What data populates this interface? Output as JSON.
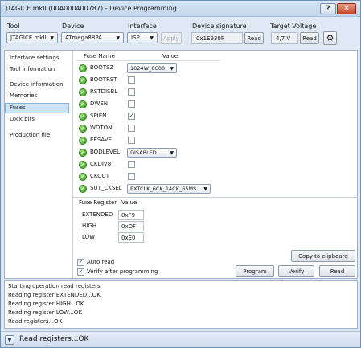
{
  "window": {
    "title": "JTAGICE mkII (00A000400787) - Device Programming"
  },
  "toolbar": {
    "tool_label": "Tool",
    "tool_value": "JTAGICE mkII",
    "device_label": "Device",
    "device_value": "ATmega88PA",
    "interface_label": "Interface",
    "interface_value": "ISP",
    "apply_label": "Apply",
    "signature_label": "Device signature",
    "signature_value": "0x1E930F",
    "read_label": "Read",
    "voltage_label": "Target Voltage",
    "voltage_value": "4,7 V"
  },
  "sidebar": {
    "items": [
      {
        "label": "Interface settings"
      },
      {
        "label": "Tool information"
      },
      {
        "label": "Device information"
      },
      {
        "label": "Memories"
      },
      {
        "label": "Fuses"
      },
      {
        "label": "Lock bits"
      },
      {
        "label": "Production file"
      }
    ],
    "selected": "Fuses"
  },
  "fuses": {
    "col_name": "Fuse Name",
    "col_value": "Value",
    "rows": [
      {
        "name": "BOOTSZ",
        "kind": "dropdown",
        "value": "1024W_0C00"
      },
      {
        "name": "BOOTRST",
        "kind": "checkbox",
        "checked": false
      },
      {
        "name": "RSTDISBL",
        "kind": "checkbox",
        "checked": false
      },
      {
        "name": "DWEN",
        "kind": "checkbox",
        "checked": false
      },
      {
        "name": "SPIEN",
        "kind": "checkbox",
        "checked": true
      },
      {
        "name": "WDTON",
        "kind": "checkbox",
        "checked": false
      },
      {
        "name": "EESAVE",
        "kind": "checkbox",
        "checked": false
      },
      {
        "name": "BODLEVEL",
        "kind": "dropdown",
        "value": "DISABLED"
      },
      {
        "name": "CKDIV8",
        "kind": "checkbox",
        "checked": false
      },
      {
        "name": "CKOUT",
        "kind": "checkbox",
        "checked": false
      },
      {
        "name": "SUT_CKSEL",
        "kind": "dropdown",
        "value": "EXTCLK_6CK_14CK_65MS"
      }
    ]
  },
  "registers": {
    "col_register": "Fuse Register",
    "col_value": "Value",
    "rows": [
      {
        "name": "EXTENDED",
        "value": "0xF9"
      },
      {
        "name": "HIGH",
        "value": "0xDF"
      },
      {
        "name": "LOW",
        "value": "0xE0"
      }
    ]
  },
  "actions": {
    "copy_label": "Copy to clipboard",
    "auto_read_label": "Auto read",
    "auto_read_checked": true,
    "verify_after_label": "Verify after programming",
    "verify_after_checked": true,
    "program_label": "Program",
    "verify_label": "Verify",
    "read_label": "Read"
  },
  "log": {
    "lines": [
      "Starting operation read registers",
      "Reading register EXTENDED...OK",
      "Reading register HIGH...OK",
      "Reading register LOW...OK",
      "Read registers...OK"
    ]
  },
  "status": {
    "text": "Read registers...OK"
  },
  "icons": {
    "ok": "check-circle-icon",
    "settings": "gear-icon",
    "help": "question-icon",
    "close": "close-icon",
    "expand": "chevron-down-icon"
  },
  "colors": {
    "ok_green": "#3a9a20",
    "selection": "#cde3f8",
    "close_red": "#c4472b"
  }
}
